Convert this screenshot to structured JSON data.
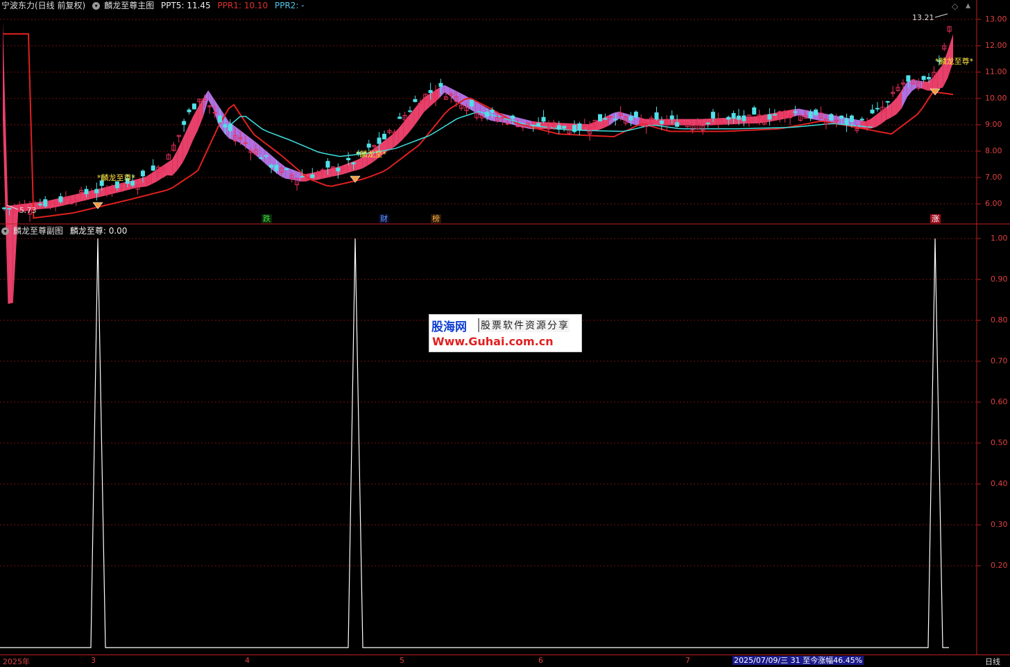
{
  "main_header": {
    "stock": "宁波东力(日线 前复权)",
    "indicator": "麟龙至尊主图",
    "ppt5_label": "PPT5: 11.45",
    "ppr1_label": "PPR1: 10.10",
    "ppr2_label": "PPR2: -"
  },
  "sub_header": {
    "indicator": "麟龙至尊副图",
    "value_label": "麟龙至尊: 0.00"
  },
  "price_axis": {
    "ticks": [
      "13.00",
      "12.00",
      "11.00",
      "10.00",
      "9.00",
      "8.00",
      "7.00",
      "6.00"
    ]
  },
  "sub_axis": {
    "ticks": [
      "1.00",
      "0.90",
      "0.80",
      "0.70",
      "0.60",
      "0.50",
      "0.40",
      "0.30",
      "0.20"
    ]
  },
  "annotations": {
    "high": "13.21",
    "low": "5.73",
    "signal_1": "*麟龙至尊*",
    "signal_2": "*麟龙至*",
    "signal_3": "*麟龙至尊*"
  },
  "events": {
    "e1": "跌",
    "e2": "财",
    "e3": "榜",
    "e4": "涨"
  },
  "time_axis": {
    "year": "2025年",
    "m3": "3",
    "m4": "4",
    "m5": "5",
    "m6": "6",
    "m7": "7",
    "period": "2025/07/09/三 31 至今涨幅46.45%",
    "period_type": "日线"
  },
  "watermark": {
    "logo": "股海网",
    "tagline": "股票软件资源分享",
    "url": "Www.Guhai.com.cn"
  },
  "colors": {
    "up": "#e8305a",
    "down": "#50e0e8",
    "band_up": "#e8406a",
    "band_down": "#b070e0",
    "ma_red": "#e02020",
    "ma_cyan": "#40e0e0",
    "grid": "#7a1010"
  },
  "sub_chart": {
    "signal_peaks": [
      {
        "date": "2025-03-03",
        "value": 1.0
      },
      {
        "date": "2025-04-23",
        "value": 1.0
      },
      {
        "date": "2025-07-08",
        "value": 1.0
      }
    ],
    "baseline_value": 0.0
  },
  "chart_data": {
    "type": "line",
    "title": "",
    "xlabel": "",
    "ylabel": "",
    "ylim": [
      5.5,
      13.3
    ],
    "x": [
      0,
      10,
      20,
      30,
      40,
      50,
      60,
      70,
      80,
      90,
      100,
      110,
      120,
      130
    ],
    "series": [
      {
        "name": "",
        "values": [
          5.8,
          5.95,
          6.2,
          6.6,
          7.2,
          10.2,
          8.6,
          7.1,
          7.3,
          8.0,
          10.0,
          9.0,
          9.1,
          9.4
        ]
      }
    ]
  }
}
